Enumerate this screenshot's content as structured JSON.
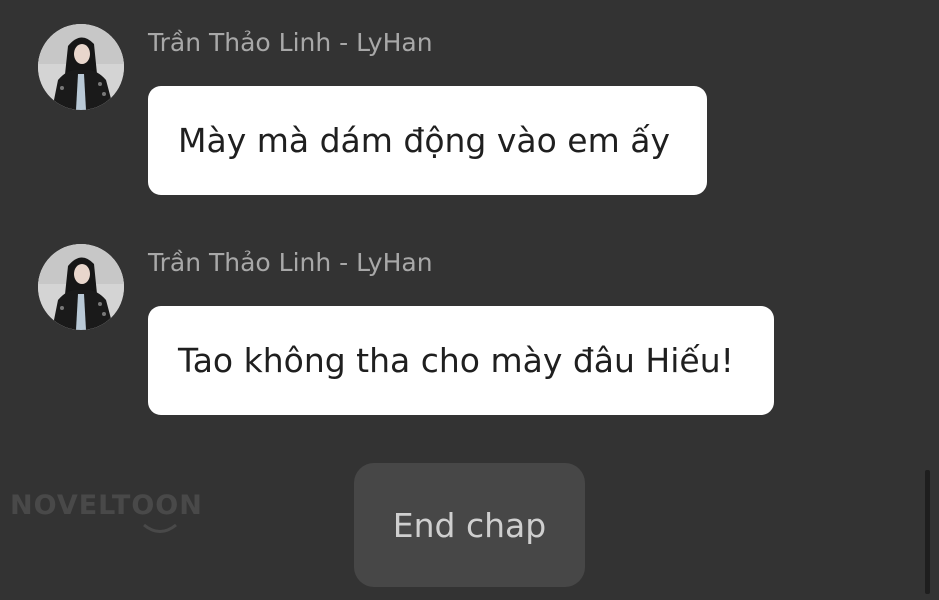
{
  "messages": [
    {
      "sender": "Trần Thảo Linh - LyHan",
      "text": "Mày mà dám động vào em ấy",
      "avatar_icon": "profile-photo"
    },
    {
      "sender": "Trần Thảo Linh - LyHan",
      "text": "Tao không tha cho mày đâu Hiếu!",
      "avatar_icon": "profile-photo"
    }
  ],
  "watermark": {
    "text": "NOVELTOON"
  },
  "end_chap": {
    "label": "End chap"
  },
  "colors": {
    "background": "#333333",
    "bubble": "#ffffff",
    "sender_text": "#a8a8a8",
    "button_bg": "#474747"
  }
}
